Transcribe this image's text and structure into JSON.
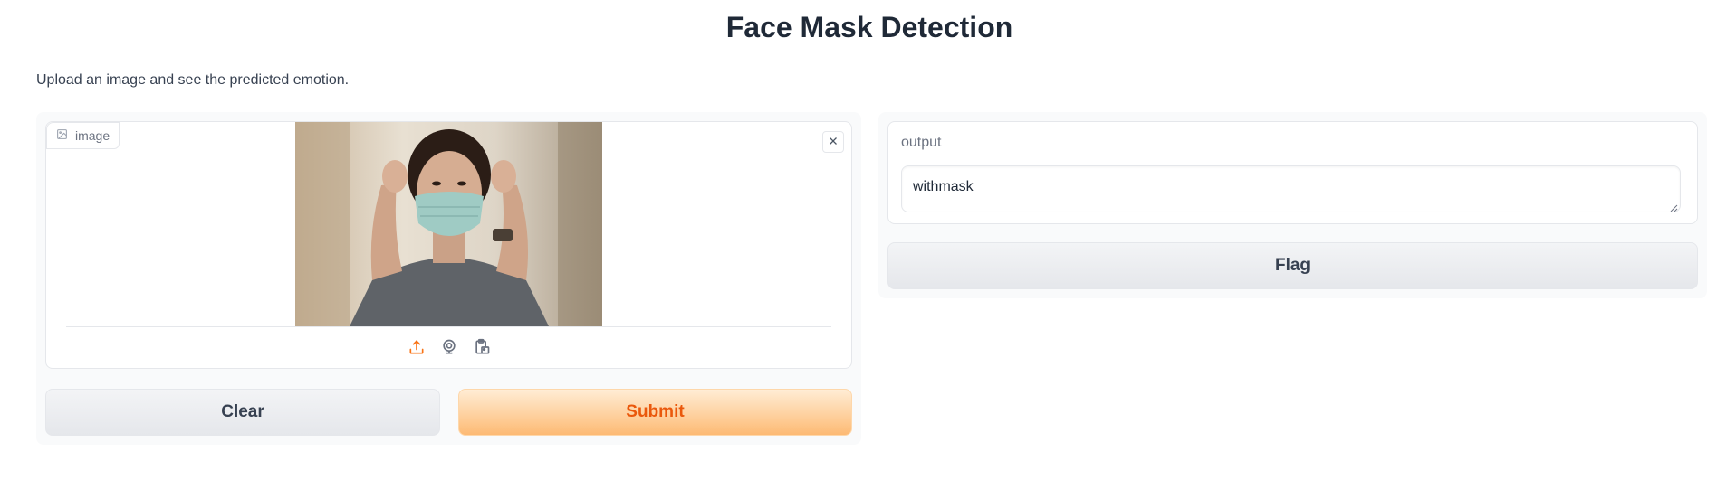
{
  "page": {
    "title": "Face Mask Detection",
    "description": "Upload an image and see the predicted emotion."
  },
  "input": {
    "label": "image",
    "label_icon": "image-icon",
    "close_icon": "close-icon",
    "source_icons": [
      "upload-icon",
      "webcam-icon",
      "clipboard-icon"
    ],
    "accent_color": "#f97316"
  },
  "actions": {
    "clear_label": "Clear",
    "submit_label": "Submit"
  },
  "output": {
    "label": "output",
    "value": "withmask",
    "flag_label": "Flag"
  }
}
